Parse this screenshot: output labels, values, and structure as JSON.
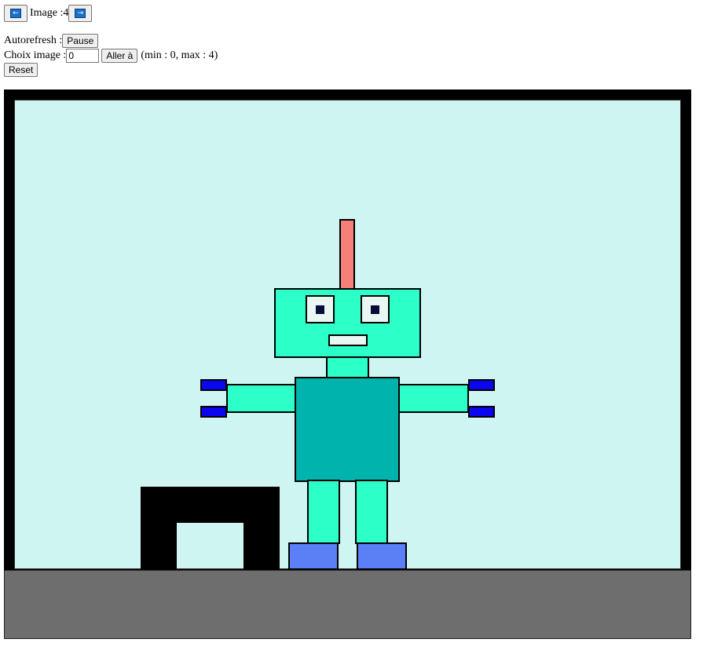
{
  "nav": {
    "prev_icon": "left-arrow-icon",
    "next_icon": "right-arrow-icon",
    "image_label": "Image : ",
    "image_number": "4"
  },
  "controls": {
    "autorefresh_label": "Autorefresh : ",
    "pause_button": "Pause",
    "choix_label": "Choix image : ",
    "choix_value": "0",
    "aller_button": "Aller à",
    "range_text": "(min : 0, max : 4)",
    "reset_button": "Reset"
  },
  "colors": {
    "frame": "#000000",
    "sky": "#cff5f2",
    "ground": "#6e6e6e",
    "robot_light": "#2dffc8",
    "robot_body": "#00b3ad",
    "antenna": "#f48079",
    "hands": "#0a06f0",
    "feet": "#5a7ff7",
    "eyes_bg": "#e9f7f3",
    "pupil": "#0b0b3a"
  }
}
